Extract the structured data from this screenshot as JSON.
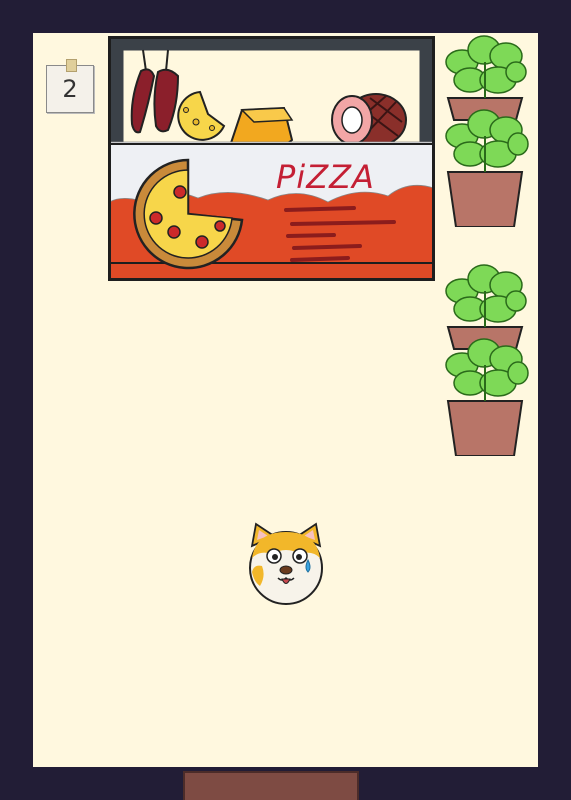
{
  "level_note": {
    "number": "2"
  },
  "shop": {
    "sign_text": "PiZZA"
  },
  "colors": {
    "frame": "#221d36",
    "floor": "#fff8df",
    "door": "#7e4b43",
    "awning_red": "#e04a26",
    "shop_frame": "#3b4148",
    "pot": "#b87568",
    "leaf": "#7ed957"
  },
  "icons": {
    "sausage": "sausage-icon",
    "cheese": "cheese-icon",
    "ham": "ham-icon",
    "pizza": "pizza-icon",
    "plant": "basil-plant-icon",
    "dog": "dog-character-icon"
  }
}
